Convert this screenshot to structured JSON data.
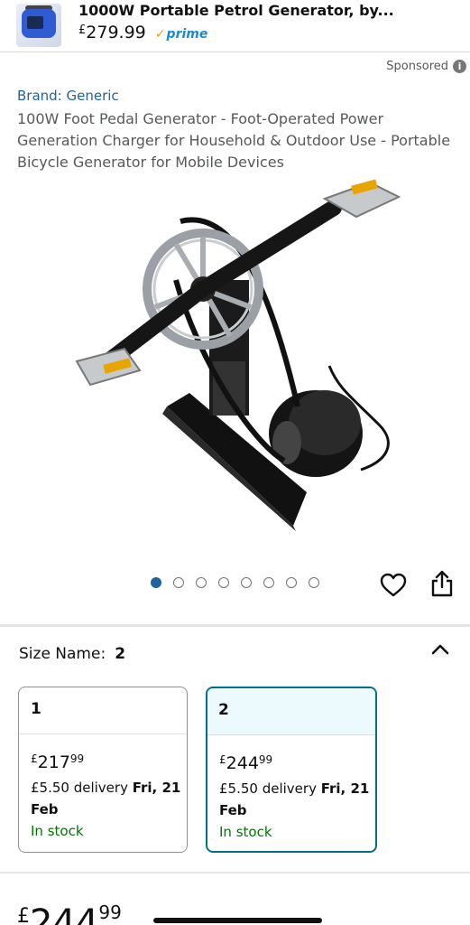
{
  "ad": {
    "title": "1000W Portable Petrol Generator, by...",
    "price_currency": "£",
    "price": "279.99",
    "prime_label": "prime",
    "thumb_icon": "generator-thumbnail"
  },
  "sponsored_label": "Sponsored",
  "product": {
    "brand": "Brand: Generic",
    "title": "100W Foot Pedal Generator - Foot-Operated Power Generation Charger for Household & Outdoor Use - Portable Bicycle Generator for Mobile Devices"
  },
  "carousel": {
    "count": 8,
    "active_index": 0
  },
  "actions": {
    "favorite_icon": "heart-icon",
    "share_icon": "share-icon"
  },
  "size": {
    "label": "Size Name:",
    "selected": "2",
    "options": [
      {
        "name": "1",
        "price_currency": "£",
        "price_whole": "217",
        "price_fraction": "99",
        "delivery_prefix": "£5.50 delivery ",
        "delivery_date": "Fri, 21 Feb",
        "stock": "In stock"
      },
      {
        "name": "2",
        "price_currency": "£",
        "price_whole": "244",
        "price_fraction": "99",
        "delivery_prefix": "£5.50 delivery ",
        "delivery_date": "Fri, 21 Feb",
        "stock": "In stock"
      }
    ]
  },
  "main_price": {
    "currency": "£",
    "whole": "244",
    "fraction": "99"
  },
  "colors": {
    "link": "#2162a1",
    "selected_border": "#007185",
    "in_stock": "#007600",
    "prime": "#1a8ad0"
  }
}
